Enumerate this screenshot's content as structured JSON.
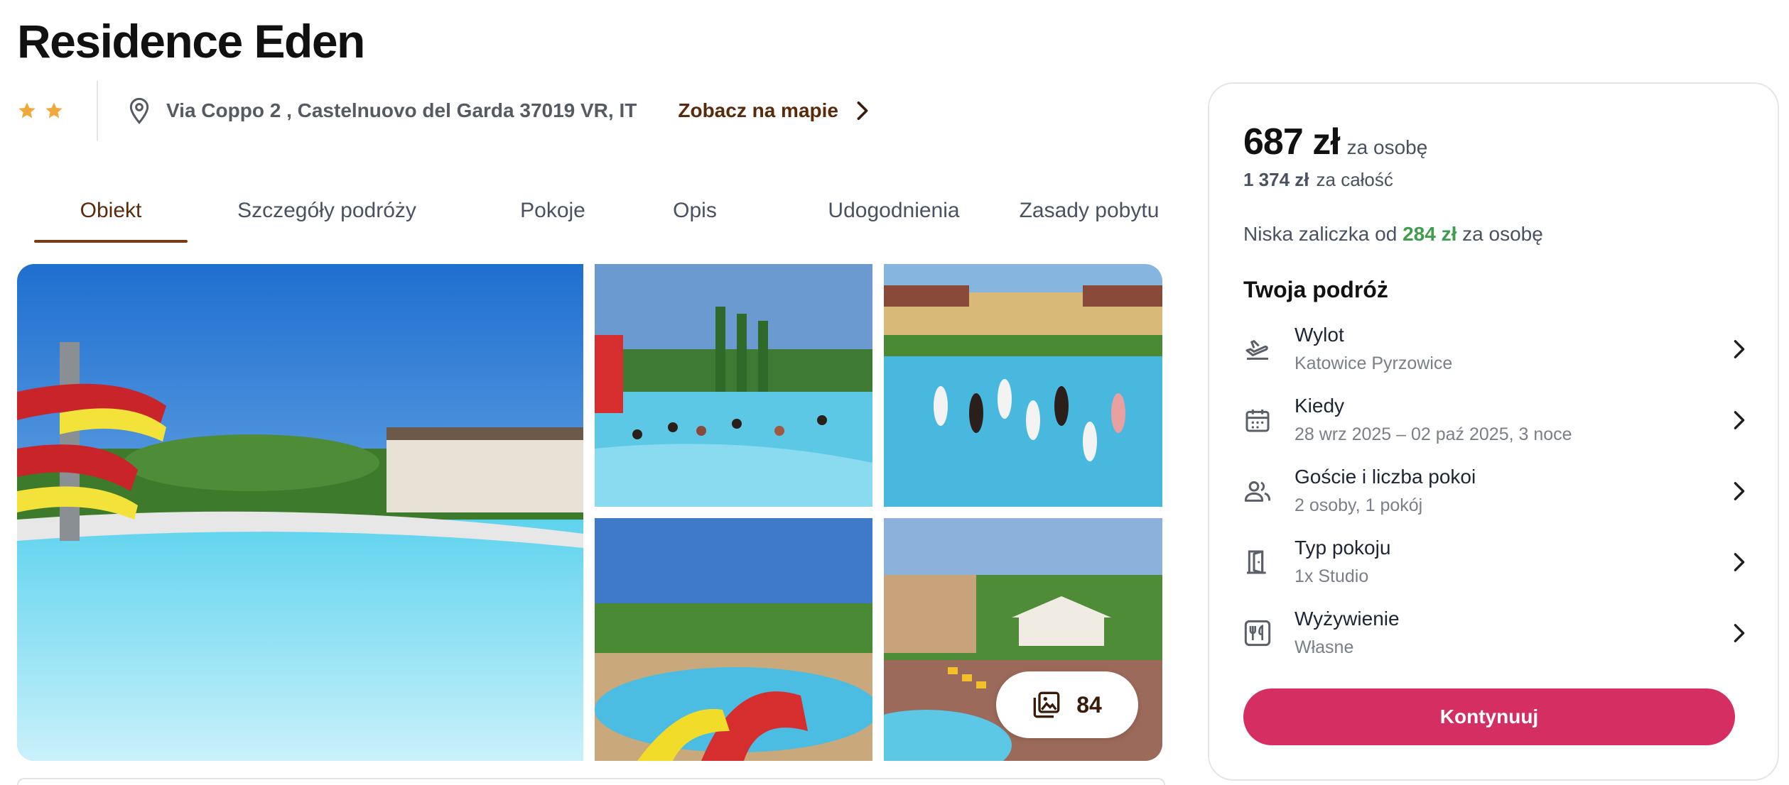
{
  "hotel": {
    "name": "Residence Eden",
    "stars": 2,
    "address": "Via Coppo 2 , Castelnuovo del Garda 37019 VR, IT",
    "map_link": "Zobacz na mapie"
  },
  "tabs": [
    {
      "label": "Obiekt",
      "active": true
    },
    {
      "label": "Szczegóły podróży",
      "active": false
    },
    {
      "label": "Pokoje",
      "active": false
    },
    {
      "label": "Opis",
      "active": false
    },
    {
      "label": "Udogodnienia",
      "active": false
    },
    {
      "label": "Zasady pobytu",
      "active": false
    }
  ],
  "gallery": {
    "photo_count": "84",
    "photos": [
      "water-slide-pool",
      "pool-with-guests",
      "aqua-aerobics-pool",
      "pool-slide-aerial",
      "resort-aerial-view"
    ]
  },
  "booking": {
    "price": "687 zł",
    "price_suffix": "za osobę",
    "total_price": "1 374 zł",
    "total_suffix": "za całość",
    "deposit_prefix": "Niska zaliczka od",
    "deposit_amount": "284 zł",
    "deposit_suffix": "za osobę",
    "trip_title": "Twoja podróż",
    "rows": [
      {
        "label": "Wylot",
        "value": "Katowice Pyrzowice",
        "icon": "plane-departure-icon"
      },
      {
        "label": "Kiedy",
        "value": "28 wrz 2025 – 02 paź 2025, 3 noce",
        "icon": "calendar-icon"
      },
      {
        "label": "Goście i liczba pokoi",
        "value": "2 osoby, 1 pokój",
        "icon": "guests-icon"
      },
      {
        "label": "Typ pokoju",
        "value": "1x Studio",
        "icon": "door-icon"
      },
      {
        "label": "Wyżywienie",
        "value": "Własne",
        "icon": "cutlery-icon"
      }
    ],
    "cta": "Kontynuuj"
  },
  "colors": {
    "accent_brown": "#5a2a0c",
    "star": "#f0a93a",
    "deposit_green": "#3f9d4d",
    "cta_pink": "#d52e63"
  }
}
